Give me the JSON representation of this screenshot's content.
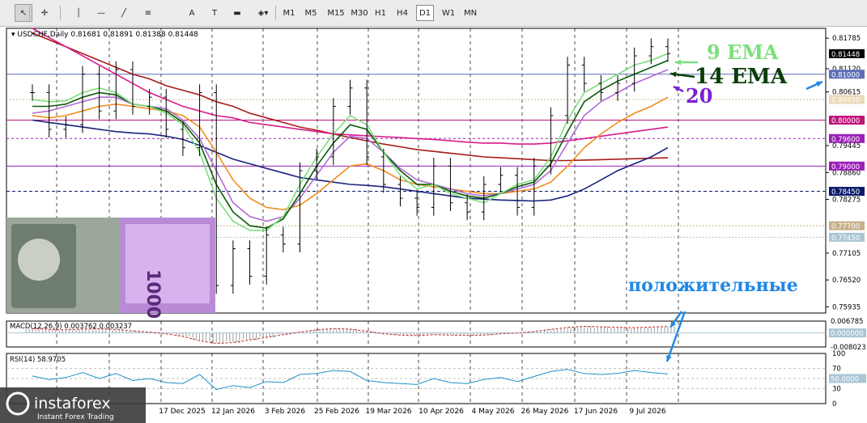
{
  "toolbar": {
    "tools": [
      {
        "name": "cursor-icon",
        "glyph": "↖"
      },
      {
        "name": "crosshair-icon",
        "glyph": "✛"
      },
      {
        "name": "vertical-line-icon",
        "glyph": "│"
      },
      {
        "name": "horizontal-line-icon",
        "glyph": "—"
      },
      {
        "name": "trendline-icon",
        "glyph": "╱"
      },
      {
        "name": "fibonacci-icon",
        "glyph": "≡"
      },
      {
        "name": "text-icon",
        "glyph": "A"
      },
      {
        "name": "text-label-icon",
        "glyph": "T"
      },
      {
        "name": "rectangle-icon",
        "glyph": "▬"
      },
      {
        "name": "shapes-menu-icon",
        "glyph": "◈▾"
      }
    ],
    "timeframes": [
      "M1",
      "M5",
      "M15",
      "M30",
      "H1",
      "H4",
      "D1",
      "W1",
      "MN"
    ],
    "active_timeframe": "D1"
  },
  "chart_header": {
    "symbol_line": "USDCHF,Daily  0.81681 0.81891 0.81388 0.81448"
  },
  "annotations": {
    "ema9": "9 EMA",
    "ema14": "14 EMA",
    "ema20": "20",
    "positive_text": "положительные",
    "colors": {
      "ema9": "#7be07b",
      "ema14": "#0a3d0a",
      "ema20": "#7a1fd6",
      "positive": "#1e88e5"
    }
  },
  "macd_header": "MACD(12,26,9) 0.003762 0.003237",
  "rsi_header": "RSI(14) 58.9705",
  "watermark": {
    "brand": "instaforex",
    "tagline": "Instant Forex Trading"
  },
  "chart_data": {
    "type": "line",
    "symbol": "USDCHF",
    "timeframe": "Daily",
    "ohlc_last": {
      "open": 0.81681,
      "high": 0.81891,
      "low": 0.81388,
      "close": 0.81448
    },
    "x_tick_labels": [
      "17 Dec 2025",
      "12 Jan 2026",
      "3 Feb 2026",
      "25 Feb 2026",
      "19 Mar 2026",
      "10 Apr 2026",
      "4 May 2026",
      "26 May 2026",
      "17 Jun 2026",
      "9 Jul 2026"
    ],
    "y_tick_labels": [
      "0.81785",
      "0.81120",
      "0.80615",
      "0.79445",
      "0.78860",
      "0.78275",
      "0.77105",
      "0.76520",
      "0.75935"
    ],
    "ylim": [
      0.758,
      0.82
    ],
    "price_tags": [
      {
        "value": "0.81448",
        "color": "#000000",
        "text_color": "#ffffff"
      },
      {
        "value": "0.81000",
        "color": "#5b6fb5",
        "text_color": "#ffffff"
      },
      {
        "value": "0.80450",
        "color": "#e8d9b8",
        "text_color": "#ffffff"
      },
      {
        "value": "0.80000",
        "color": "#c0147a",
        "text_color": "#ffffff"
      },
      {
        "value": "0.79600",
        "color": "#9b1fb8",
        "text_color": "#ffffff"
      },
      {
        "value": "0.79000",
        "color": "#9b1fb8",
        "text_color": "#ffffff"
      },
      {
        "value": "0.78450",
        "color": "#0a1a6b",
        "text_color": "#ffffff"
      },
      {
        "value": "0.77700",
        "color": "#c9b08a",
        "text_color": "#ffffff"
      },
      {
        "value": "0.77450",
        "color": "#a9c6d6",
        "text_color": "#ffffff"
      }
    ],
    "horizontal_levels": [
      {
        "value": 0.81,
        "color": "#5b6fb5",
        "dash": ""
      },
      {
        "value": 0.8045,
        "color": "#cdbb95",
        "dash": "2,2"
      },
      {
        "value": 0.8,
        "color": "#c0147a",
        "dash": ""
      },
      {
        "value": 0.796,
        "color": "#9b1fb8",
        "dash": "3,3"
      },
      {
        "value": 0.79,
        "color": "#9b1fb8",
        "dash": ""
      },
      {
        "value": 0.7845,
        "color": "#0a1a6b",
        "dash": "4,3"
      },
      {
        "value": 0.777,
        "color": "#c9b08a",
        "dash": "2,2"
      },
      {
        "value": 0.7745,
        "color": "#a9c6d6",
        "dash": "2,2"
      }
    ],
    "series": [
      {
        "name": "9 EMA",
        "color": "#7be07b",
        "values": [
          0.8045,
          0.804,
          0.8042,
          0.806,
          0.807,
          0.806,
          0.8035,
          0.803,
          0.8015,
          0.799,
          0.793,
          0.783,
          0.778,
          0.776,
          0.776,
          0.779,
          0.786,
          0.792,
          0.797,
          0.801,
          0.799,
          0.793,
          0.788,
          0.785,
          0.786,
          0.784,
          0.783,
          0.782,
          0.784,
          0.786,
          0.787,
          0.792,
          0.8,
          0.806,
          0.808,
          0.81,
          0.812,
          0.813,
          0.8145
        ]
      },
      {
        "name": "14 EMA",
        "color": "#0a5a0a",
        "values": [
          0.803,
          0.803,
          0.8035,
          0.805,
          0.806,
          0.8055,
          0.8035,
          0.803,
          0.802,
          0.7995,
          0.795,
          0.786,
          0.78,
          0.777,
          0.7765,
          0.7785,
          0.784,
          0.79,
          0.795,
          0.799,
          0.798,
          0.793,
          0.789,
          0.786,
          0.786,
          0.7845,
          0.7835,
          0.783,
          0.784,
          0.7855,
          0.7865,
          0.7905,
          0.7975,
          0.804,
          0.8065,
          0.8085,
          0.81,
          0.8115,
          0.813
        ]
      },
      {
        "name": "20",
        "color": "#b36bd6",
        "values": [
          0.8015,
          0.802,
          0.803,
          0.804,
          0.805,
          0.805,
          0.8035,
          0.803,
          0.8025,
          0.8,
          0.796,
          0.789,
          0.782,
          0.779,
          0.778,
          0.779,
          0.783,
          0.788,
          0.793,
          0.7965,
          0.796,
          0.793,
          0.7895,
          0.787,
          0.786,
          0.785,
          0.784,
          0.7835,
          0.784,
          0.785,
          0.786,
          0.789,
          0.795,
          0.801,
          0.804,
          0.806,
          0.808,
          0.8095,
          0.811
        ]
      },
      {
        "name": "",
        "color": "#f28c1e",
        "values": [
          0.801,
          0.8005,
          0.801,
          0.802,
          0.803,
          0.8035,
          0.803,
          0.8025,
          0.802,
          0.801,
          0.7985,
          0.793,
          0.787,
          0.783,
          0.781,
          0.7805,
          0.7815,
          0.784,
          0.787,
          0.79,
          0.7905,
          0.789,
          0.787,
          0.786,
          0.7855,
          0.785,
          0.7845,
          0.784,
          0.784,
          0.7845,
          0.785,
          0.7865,
          0.79,
          0.794,
          0.797,
          0.7995,
          0.8015,
          0.803,
          0.805
        ]
      },
      {
        "name": "",
        "color": "#1a237e",
        "values": [
          0.8,
          0.7995,
          0.799,
          0.7985,
          0.798,
          0.7975,
          0.7972,
          0.797,
          0.7965,
          0.7958,
          0.7945,
          0.793,
          0.7915,
          0.7905,
          0.7895,
          0.7885,
          0.7875,
          0.787,
          0.7865,
          0.786,
          0.7858,
          0.7855,
          0.785,
          0.7845,
          0.784,
          0.7835,
          0.783,
          0.7828,
          0.7826,
          0.7825,
          0.7824,
          0.7826,
          0.7835,
          0.785,
          0.787,
          0.789,
          0.7905,
          0.792,
          0.794
        ]
      },
      {
        "name": "",
        "color": "#d81b8a",
        "values": [
          0.82,
          0.818,
          0.816,
          0.814,
          0.812,
          0.81,
          0.808,
          0.806,
          0.8045,
          0.803,
          0.802,
          0.801,
          0.8005,
          0.7995,
          0.799,
          0.7985,
          0.798,
          0.7975,
          0.797,
          0.7968,
          0.7966,
          0.7964,
          0.7962,
          0.796,
          0.7958,
          0.7955,
          0.7952,
          0.795,
          0.795,
          0.7948,
          0.7948,
          0.795,
          0.7955,
          0.796,
          0.7965,
          0.797,
          0.7975,
          0.798,
          0.7985
        ]
      },
      {
        "name": "",
        "color": "#a61b1b",
        "values": [
          0.819,
          0.8175,
          0.816,
          0.8145,
          0.813,
          0.8115,
          0.81,
          0.809,
          0.8075,
          0.8065,
          0.8055,
          0.804,
          0.803,
          0.8015,
          0.8005,
          0.7995,
          0.7985,
          0.7978,
          0.797,
          0.7962,
          0.7955,
          0.7948,
          0.7942,
          0.7936,
          0.7932,
          0.7928,
          0.7924,
          0.792,
          0.7918,
          0.7916,
          0.7914,
          0.7912,
          0.7912,
          0.7913,
          0.7914,
          0.7915,
          0.7916,
          0.7917,
          0.7918
        ]
      }
    ],
    "price": {
      "name": "",
      "color": "#000000",
      "values": [
        0.806,
        0.798,
        0.799,
        0.81,
        0.802,
        0.811,
        0.803,
        0.805,
        0.798,
        0.794,
        0.806,
        0.764,
        0.772,
        0.766,
        0.775,
        0.773,
        0.789,
        0.792,
        0.803,
        0.807,
        0.792,
        0.786,
        0.783,
        0.781,
        0.79,
        0.782,
        0.78,
        0.786,
        0.788,
        0.781,
        0.79,
        0.801,
        0.812,
        0.808,
        0.806,
        0.808,
        0.814,
        0.816,
        0.8145
      ]
    },
    "macd": {
      "ylim": [
        -0.008023,
        0.006785
      ],
      "tick_labels": [
        "0.006785",
        "0.000000",
        "-0.008023"
      ],
      "values": [
        0.0025,
        0.002,
        0.0018,
        0.0022,
        0.0024,
        0.002,
        0.0012,
        0.0005,
        -0.0005,
        -0.002,
        -0.0045,
        -0.006,
        -0.0055,
        -0.004,
        -0.0025,
        -0.001,
        0.0005,
        0.0018,
        0.0025,
        0.0022,
        0.001,
        -0.0005,
        -0.0012,
        -0.0015,
        -0.001,
        -0.0012,
        -0.0014,
        -0.0012,
        -0.0005,
        0.0,
        0.0008,
        0.002,
        0.0032,
        0.0038,
        0.0035,
        0.0032,
        0.003,
        0.0034,
        0.0037
      ]
    },
    "rsi": {
      "ylim": [
        0,
        100
      ],
      "tick_labels": [
        "100",
        "70",
        "50",
        "30",
        "0"
      ],
      "values": [
        55,
        48,
        52,
        62,
        50,
        60,
        46,
        50,
        42,
        40,
        58,
        28,
        36,
        32,
        44,
        42,
        58,
        60,
        66,
        64,
        46,
        42,
        40,
        38,
        50,
        42,
        40,
        48,
        52,
        44,
        54,
        64,
        68,
        60,
        58,
        60,
        66,
        62,
        59
      ]
    }
  }
}
